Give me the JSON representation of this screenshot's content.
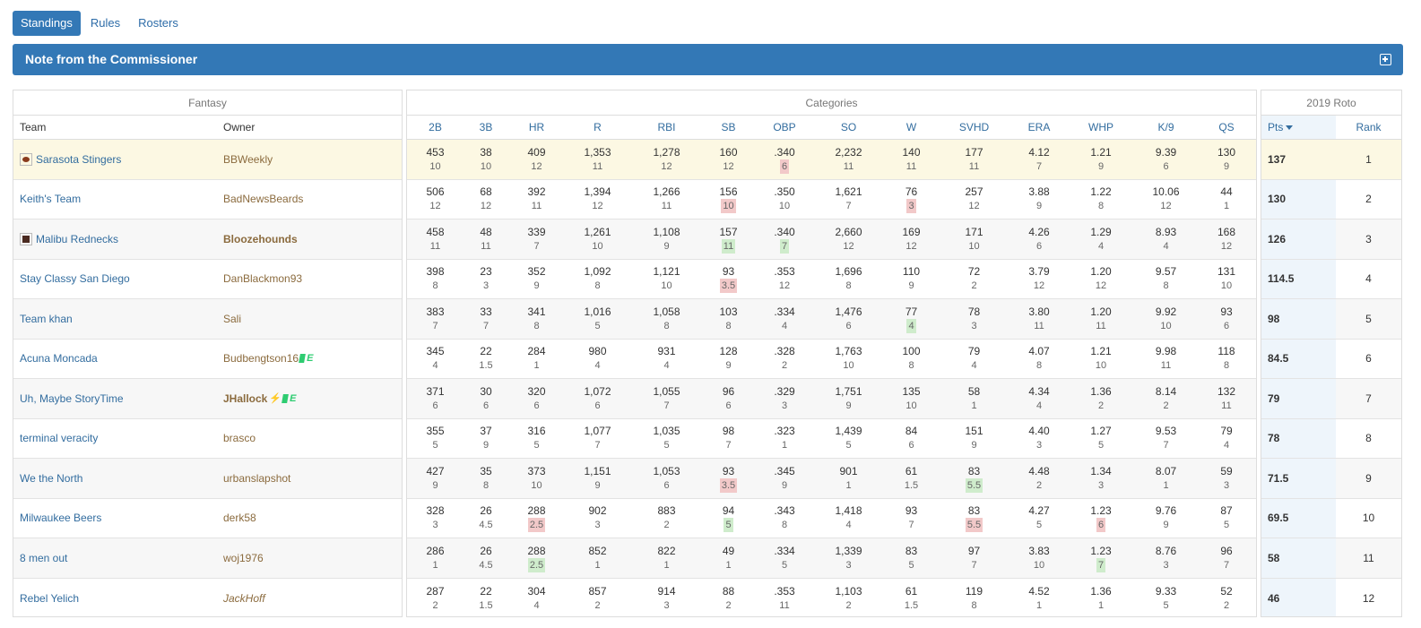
{
  "tabs": [
    {
      "label": "Standings",
      "active": true
    },
    {
      "label": "Rules",
      "active": false
    },
    {
      "label": "Rosters",
      "active": false
    }
  ],
  "note": {
    "title": "Note from the Commissioner",
    "icon": "expand-plus-icon"
  },
  "groups": {
    "fantasy": "Fantasy",
    "categories": "Categories",
    "roto": "2019 Roto"
  },
  "columns": {
    "team": "Team",
    "owner": "Owner",
    "categories": [
      "2B",
      "3B",
      "HR",
      "R",
      "RBI",
      "SB",
      "OBP",
      "SO",
      "W",
      "SVHD",
      "ERA",
      "WHP",
      "K/9",
      "QS"
    ],
    "pts": "Pts",
    "rank": "Rank"
  },
  "highlight_colors": {
    "down": "#f2c9c9",
    "up": "#cfeccc",
    "my_team": "#fcf8e3"
  },
  "rows": [
    {
      "team": "Sarasota Stingers",
      "logo": "football-logo-icon",
      "owner": "BBWeekly",
      "owner_style": "",
      "mine": true,
      "vals": [
        "453",
        "38",
        "409",
        "1,353",
        "1,278",
        "160",
        ".340",
        "2,232",
        "140",
        "177",
        "4.12",
        "1.21",
        "9.39",
        "130"
      ],
      "pts": [
        "10",
        "10",
        "12",
        "11",
        "12",
        "12",
        "6",
        "11",
        "11",
        "11",
        "7",
        "9",
        "6",
        "9"
      ],
      "hl": [
        "",
        "",
        "",
        "",
        "",
        "",
        "down",
        "",
        "",
        "",
        "",
        "",
        "",
        ""
      ],
      "total": "137",
      "rank": "1"
    },
    {
      "team": "Keith's Team",
      "logo": "",
      "owner": "BadNewsBeards",
      "owner_style": "",
      "mine": false,
      "vals": [
        "506",
        "68",
        "392",
        "1,394",
        "1,266",
        "156",
        ".350",
        "1,621",
        "76",
        "257",
        "3.88",
        "1.22",
        "10.06",
        "44"
      ],
      "pts": [
        "12",
        "12",
        "11",
        "12",
        "11",
        "10",
        "10",
        "7",
        "3",
        "12",
        "9",
        "8",
        "12",
        "1"
      ],
      "hl": [
        "",
        "",
        "",
        "",
        "",
        "down",
        "",
        "",
        "down",
        "",
        "",
        "",
        "",
        ""
      ],
      "total": "130",
      "rank": "2"
    },
    {
      "team": "Malibu Rednecks",
      "logo": "cow-logo-icon",
      "owner": "Bloozehounds",
      "owner_style": "bold",
      "mine": false,
      "vals": [
        "458",
        "48",
        "339",
        "1,261",
        "1,108",
        "157",
        ".340",
        "2,660",
        "169",
        "171",
        "4.26",
        "1.29",
        "8.93",
        "168"
      ],
      "pts": [
        "11",
        "11",
        "7",
        "10",
        "9",
        "11",
        "7",
        "12",
        "12",
        "10",
        "6",
        "4",
        "4",
        "12"
      ],
      "hl": [
        "",
        "",
        "",
        "",
        "",
        "up",
        "up",
        "",
        "",
        "",
        "",
        "",
        "",
        ""
      ],
      "total": "126",
      "rank": "3"
    },
    {
      "team": "Stay Classy San Diego",
      "logo": "",
      "owner": "DanBlackmon93",
      "owner_style": "",
      "mine": false,
      "vals": [
        "398",
        "23",
        "352",
        "1,092",
        "1,121",
        "93",
        ".353",
        "1,696",
        "110",
        "72",
        "3.79",
        "1.20",
        "9.57",
        "131"
      ],
      "pts": [
        "8",
        "3",
        "9",
        "8",
        "10",
        "3.5",
        "12",
        "8",
        "9",
        "2",
        "12",
        "12",
        "8",
        "10"
      ],
      "hl": [
        "",
        "",
        "",
        "",
        "",
        "down",
        "",
        "",
        "",
        "",
        "",
        "",
        "",
        ""
      ],
      "total": "114.5",
      "rank": "4"
    },
    {
      "team": "Team khan",
      "logo": "",
      "owner": "Sali",
      "owner_style": "",
      "mine": false,
      "vals": [
        "383",
        "33",
        "341",
        "1,016",
        "1,058",
        "103",
        ".334",
        "1,476",
        "77",
        "78",
        "3.80",
        "1.20",
        "9.92",
        "93"
      ],
      "pts": [
        "7",
        "7",
        "8",
        "5",
        "8",
        "8",
        "4",
        "6",
        "4",
        "3",
        "11",
        "11",
        "10",
        "6"
      ],
      "hl": [
        "",
        "",
        "",
        "",
        "",
        "",
        "",
        "",
        "up",
        "",
        "",
        "",
        "",
        ""
      ],
      "total": "98",
      "rank": "5"
    },
    {
      "team": "Acuna Moncada",
      "logo": "",
      "owner": "Budbengtson16",
      "owner_style": "",
      "badges": [
        "green-badge-icon",
        "e-badge-icon"
      ],
      "mine": false,
      "vals": [
        "345",
        "22",
        "284",
        "980",
        "931",
        "128",
        ".328",
        "1,763",
        "100",
        "79",
        "4.07",
        "1.21",
        "9.98",
        "118"
      ],
      "pts": [
        "4",
        "1.5",
        "1",
        "4",
        "4",
        "9",
        "2",
        "10",
        "8",
        "4",
        "8",
        "10",
        "11",
        "8"
      ],
      "hl": [
        "",
        "",
        "",
        "",
        "",
        "",
        "",
        "",
        "",
        "",
        "",
        "",
        "",
        ""
      ],
      "total": "84.5",
      "rank": "6"
    },
    {
      "team": "Uh, Maybe StoryTime",
      "logo": "",
      "owner": "JHallock",
      "owner_style": "bold",
      "badges": [
        "bolt-badge-icon",
        "green-badge-icon",
        "e-badge-icon"
      ],
      "mine": false,
      "vals": [
        "371",
        "30",
        "320",
        "1,072",
        "1,055",
        "96",
        ".329",
        "1,751",
        "135",
        "58",
        "4.34",
        "1.36",
        "8.14",
        "132"
      ],
      "pts": [
        "6",
        "6",
        "6",
        "6",
        "7",
        "6",
        "3",
        "9",
        "10",
        "1",
        "4",
        "2",
        "2",
        "11"
      ],
      "hl": [
        "",
        "",
        "",
        "",
        "",
        "",
        "",
        "",
        "",
        "",
        "",
        "",
        "",
        ""
      ],
      "total": "79",
      "rank": "7"
    },
    {
      "team": "terminal veracity",
      "logo": "",
      "owner": "brasco",
      "owner_style": "",
      "mine": false,
      "vals": [
        "355",
        "37",
        "316",
        "1,077",
        "1,035",
        "98",
        ".323",
        "1,439",
        "84",
        "151",
        "4.40",
        "1.27",
        "9.53",
        "79"
      ],
      "pts": [
        "5",
        "9",
        "5",
        "7",
        "5",
        "7",
        "1",
        "5",
        "6",
        "9",
        "3",
        "5",
        "7",
        "4"
      ],
      "hl": [
        "",
        "",
        "",
        "",
        "",
        "",
        "",
        "",
        "",
        "",
        "",
        "",
        "",
        ""
      ],
      "total": "78",
      "rank": "8"
    },
    {
      "team": "We the North",
      "logo": "",
      "owner": "urbanslapshot",
      "owner_style": "",
      "mine": false,
      "vals": [
        "427",
        "35",
        "373",
        "1,151",
        "1,053",
        "93",
        ".345",
        "901",
        "61",
        "83",
        "4.48",
        "1.34",
        "8.07",
        "59"
      ],
      "pts": [
        "9",
        "8",
        "10",
        "9",
        "6",
        "3.5",
        "9",
        "1",
        "1.5",
        "5.5",
        "2",
        "3",
        "1",
        "3"
      ],
      "hl": [
        "",
        "",
        "",
        "",
        "",
        "down",
        "",
        "",
        "",
        "up",
        "",
        "",
        "",
        ""
      ],
      "total": "71.5",
      "rank": "9"
    },
    {
      "team": "Milwaukee Beers",
      "logo": "",
      "owner": "derk58",
      "owner_style": "",
      "mine": false,
      "vals": [
        "328",
        "26",
        "288",
        "902",
        "883",
        "94",
        ".343",
        "1,418",
        "93",
        "83",
        "4.27",
        "1.23",
        "9.76",
        "87"
      ],
      "pts": [
        "3",
        "4.5",
        "2.5",
        "3",
        "2",
        "5",
        "8",
        "4",
        "7",
        "5.5",
        "5",
        "6",
        "9",
        "5"
      ],
      "hl": [
        "",
        "",
        "down",
        "",
        "",
        "up",
        "",
        "",
        "",
        "down",
        "",
        "down",
        "",
        ""
      ],
      "total": "69.5",
      "rank": "10"
    },
    {
      "team": "8 men out",
      "logo": "",
      "owner": "woj1976",
      "owner_style": "",
      "mine": false,
      "vals": [
        "286",
        "26",
        "288",
        "852",
        "822",
        "49",
        ".334",
        "1,339",
        "83",
        "97",
        "3.83",
        "1.23",
        "8.76",
        "96"
      ],
      "pts": [
        "1",
        "4.5",
        "2.5",
        "1",
        "1",
        "1",
        "5",
        "3",
        "5",
        "7",
        "10",
        "7",
        "3",
        "7"
      ],
      "hl": [
        "",
        "",
        "up",
        "",
        "",
        "",
        "",
        "",
        "",
        "",
        "",
        "up",
        "",
        ""
      ],
      "total": "58",
      "rank": "11"
    },
    {
      "team": "Rebel Yelich",
      "logo": "",
      "owner": "JackHoff",
      "owner_style": "italic",
      "mine": false,
      "vals": [
        "287",
        "22",
        "304",
        "857",
        "914",
        "88",
        ".353",
        "1,103",
        "61",
        "119",
        "4.52",
        "1.36",
        "9.33",
        "52"
      ],
      "pts": [
        "2",
        "1.5",
        "4",
        "2",
        "3",
        "2",
        "11",
        "2",
        "1.5",
        "8",
        "1",
        "1",
        "5",
        "2"
      ],
      "hl": [
        "",
        "",
        "",
        "",
        "",
        "",
        "",
        "",
        "",
        "",
        "",
        "",
        "",
        ""
      ],
      "total": "46",
      "rank": "12"
    }
  ]
}
